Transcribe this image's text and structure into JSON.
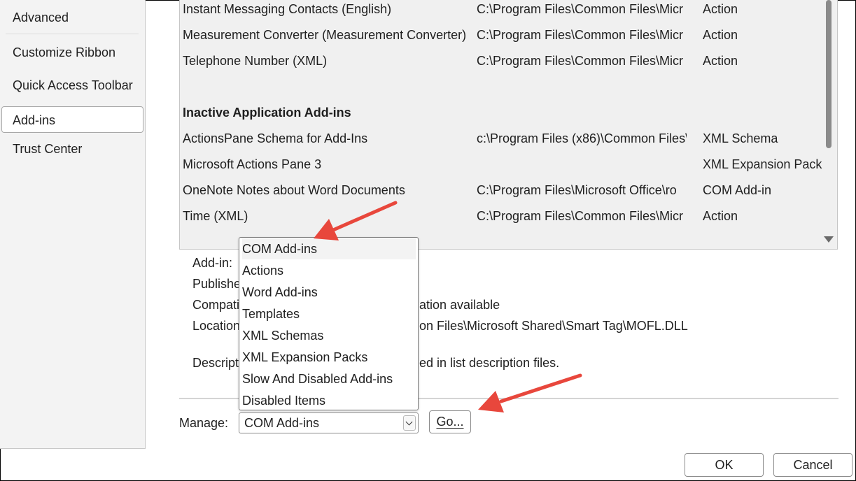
{
  "sidebar": {
    "items": [
      {
        "label": "Advanced"
      },
      {
        "label": "Customize Ribbon"
      },
      {
        "label": "Quick Access Toolbar"
      },
      {
        "label": "Add-ins",
        "selected": true
      },
      {
        "label": "Trust Center"
      }
    ]
  },
  "addins_list": {
    "active_rows": [
      {
        "name": "Instant Messaging Contacts (English)",
        "location": "C:\\Program Files\\Common Files\\Micr",
        "type": "Action"
      },
      {
        "name": "Measurement Converter (Measurement Converter)",
        "location": "C:\\Program Files\\Common Files\\Micr",
        "type": "Action"
      },
      {
        "name": "Telephone Number (XML)",
        "location": "C:\\Program Files\\Common Files\\Micr",
        "type": "Action"
      }
    ],
    "inactive_header": "Inactive Application Add-ins",
    "inactive_rows": [
      {
        "name": "ActionsPane Schema for Add-Ins",
        "location": "c:\\Program Files (x86)\\Common Files\\",
        "type": "XML Schema"
      },
      {
        "name": "Microsoft Actions Pane 3",
        "location": "",
        "type": "XML Expansion Pack"
      },
      {
        "name": "OneNote Notes about Word Documents",
        "location": "C:\\Program Files\\Microsoft Office\\ro",
        "type": "COM Add-in"
      },
      {
        "name": "Time (XML)",
        "location": "C:\\Program Files\\Common Files\\Micr",
        "type": "Action"
      }
    ]
  },
  "details": {
    "addin_label": "Add-in:",
    "publisher_label": "Publishe",
    "compat_label": "Compati",
    "compat_value": "ation available",
    "location_label": "Location",
    "location_value": "on Files\\Microsoft Shared\\Smart Tag\\MOFL.DLL",
    "description_label": "Descript",
    "description_value": "ed in list description files."
  },
  "manage": {
    "label": "Manage:",
    "selected": "COM Add-ins",
    "go_label": "Go...",
    "options": [
      "COM Add-ins",
      "Actions",
      "Word Add-ins",
      "Templates",
      "XML Schemas",
      "XML Expansion Packs",
      "Slow And Disabled Add-ins",
      "Disabled Items"
    ]
  },
  "footer": {
    "ok_label": "OK",
    "cancel_label": "Cancel"
  },
  "colors": {
    "annotation_arrow": "#e8473c",
    "list_background": "#f0f0f0"
  }
}
